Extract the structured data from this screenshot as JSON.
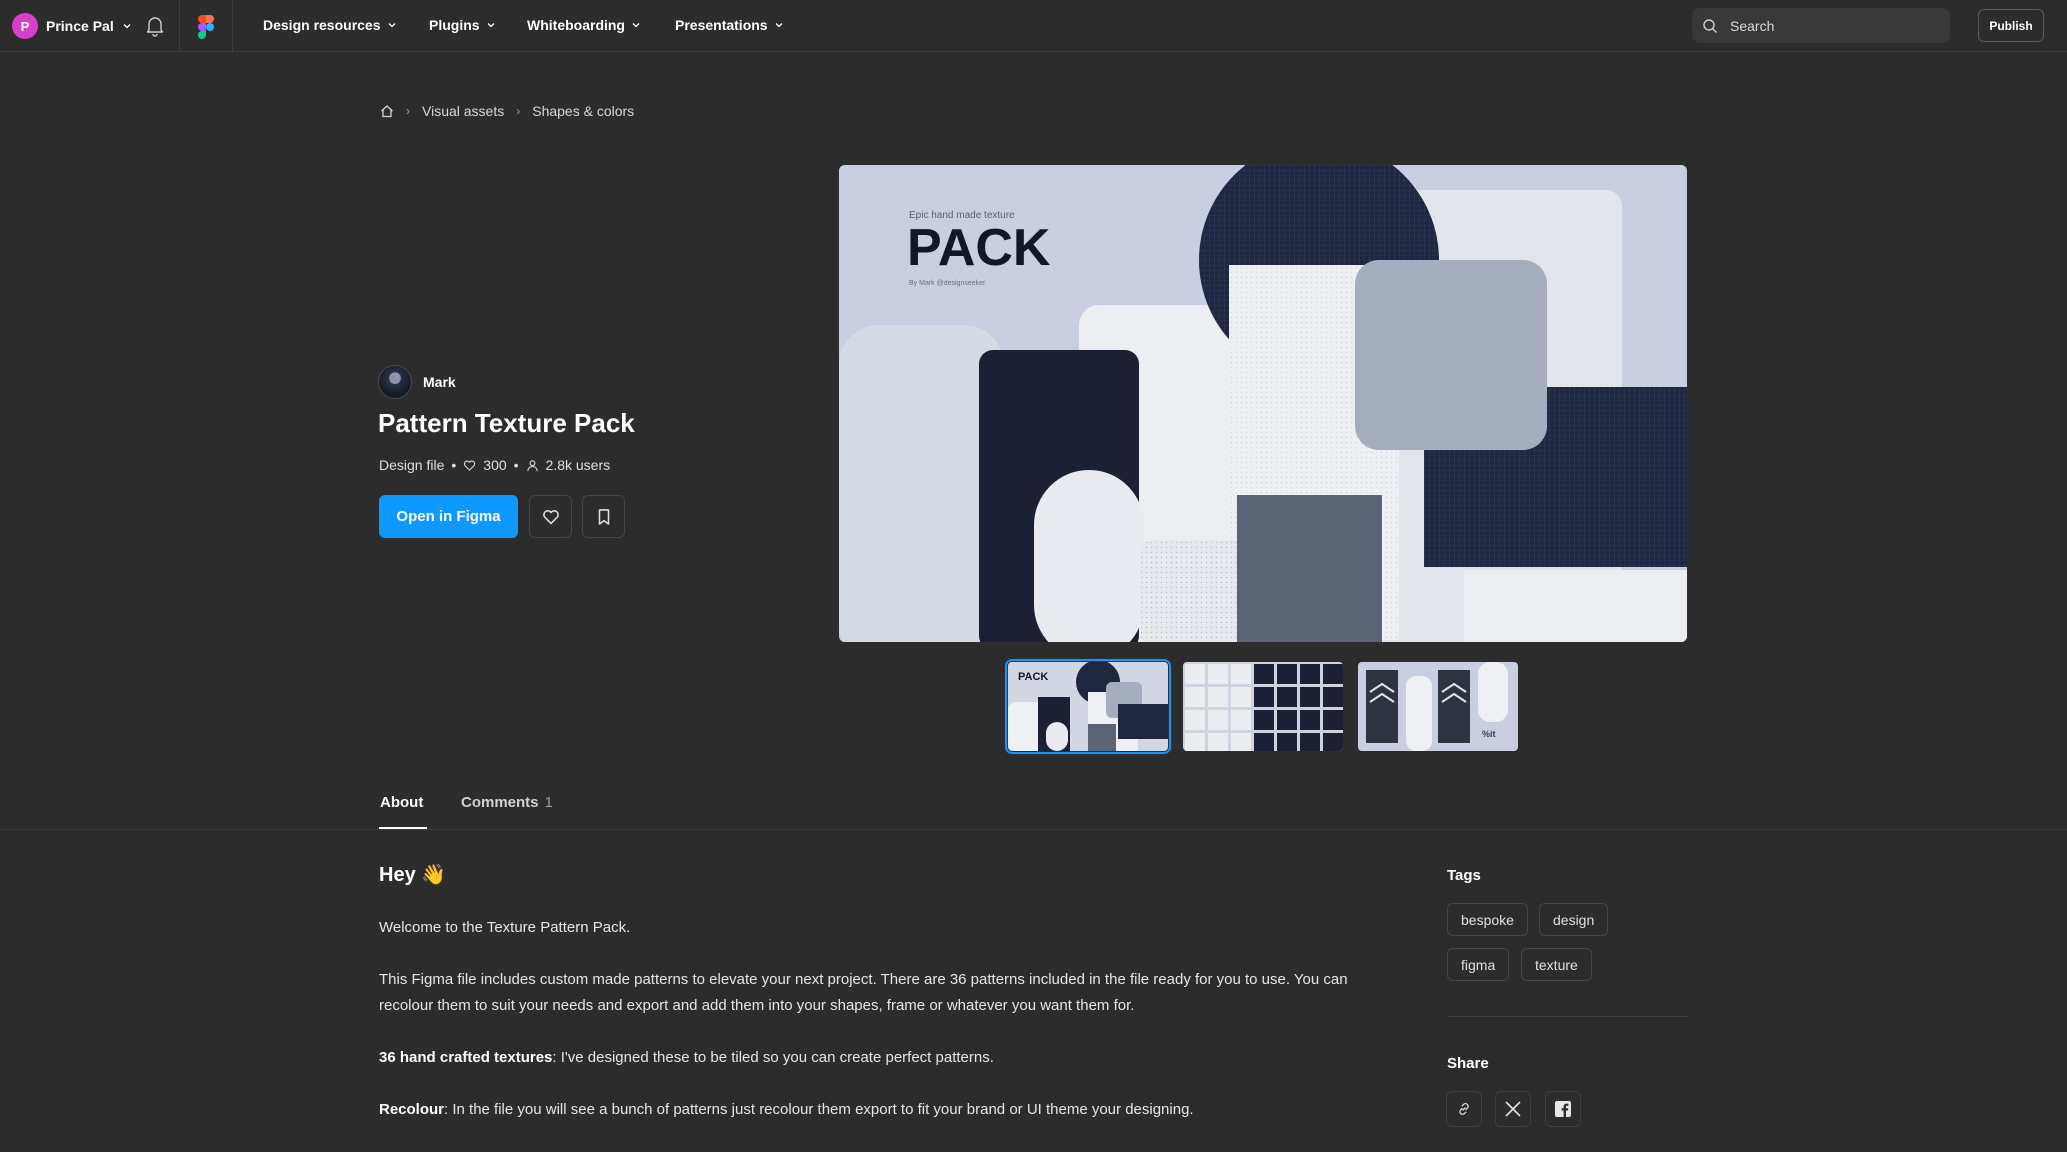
{
  "nav": {
    "user_initial": "P",
    "user_name": "Prince Pal",
    "items": [
      {
        "label": "Design resources"
      },
      {
        "label": "Plugins"
      },
      {
        "label": "Whiteboarding"
      },
      {
        "label": "Presentations"
      }
    ],
    "search_placeholder": "Search",
    "publish_label": "Publish"
  },
  "breadcrumb": {
    "home_icon": "home-icon",
    "items": [
      "Visual assets",
      "Shapes & colors"
    ]
  },
  "file": {
    "author": "Mark",
    "title": "Pattern Texture Pack",
    "type": "Design file",
    "likes": "300",
    "users": "2.8k users",
    "open_label": "Open in Figma"
  },
  "preview": {
    "caption_small": "Epic hand made texture",
    "caption_big": "PACK",
    "caption_by": "By Mark @designseeker",
    "thumb1_label": "PACK",
    "thumb3_label": "%it"
  },
  "tabs": {
    "about": "About",
    "comments": "Comments",
    "comments_count": "1"
  },
  "about": {
    "heading": "Hey 👋",
    "p1": "Welcome to the Texture Pattern Pack.",
    "p2": "This Figma file includes custom made patterns to elevate your next project. There are 36 patterns included in the file ready for you to use. You can recolour them to suit your needs and export and add them into your shapes, frame or whatever you want them for.",
    "p3_bold": "36 hand crafted textures",
    "p3_rest": ": I've designed these to be tiled so you can create perfect patterns.",
    "p4_bold": "Recolour",
    "p4_rest": ": In the file you will see a bunch of patterns just recolour them export to fit your brand or UI theme your designing."
  },
  "sidebar": {
    "tags_heading": "Tags",
    "tags": [
      "bespoke",
      "design",
      "figma",
      "texture"
    ],
    "share_heading": "Share"
  },
  "colors": {
    "background": "#2c2c2c",
    "accent": "#0d99ff",
    "avatar": "#d63fc7",
    "navy": "#1b2035"
  }
}
